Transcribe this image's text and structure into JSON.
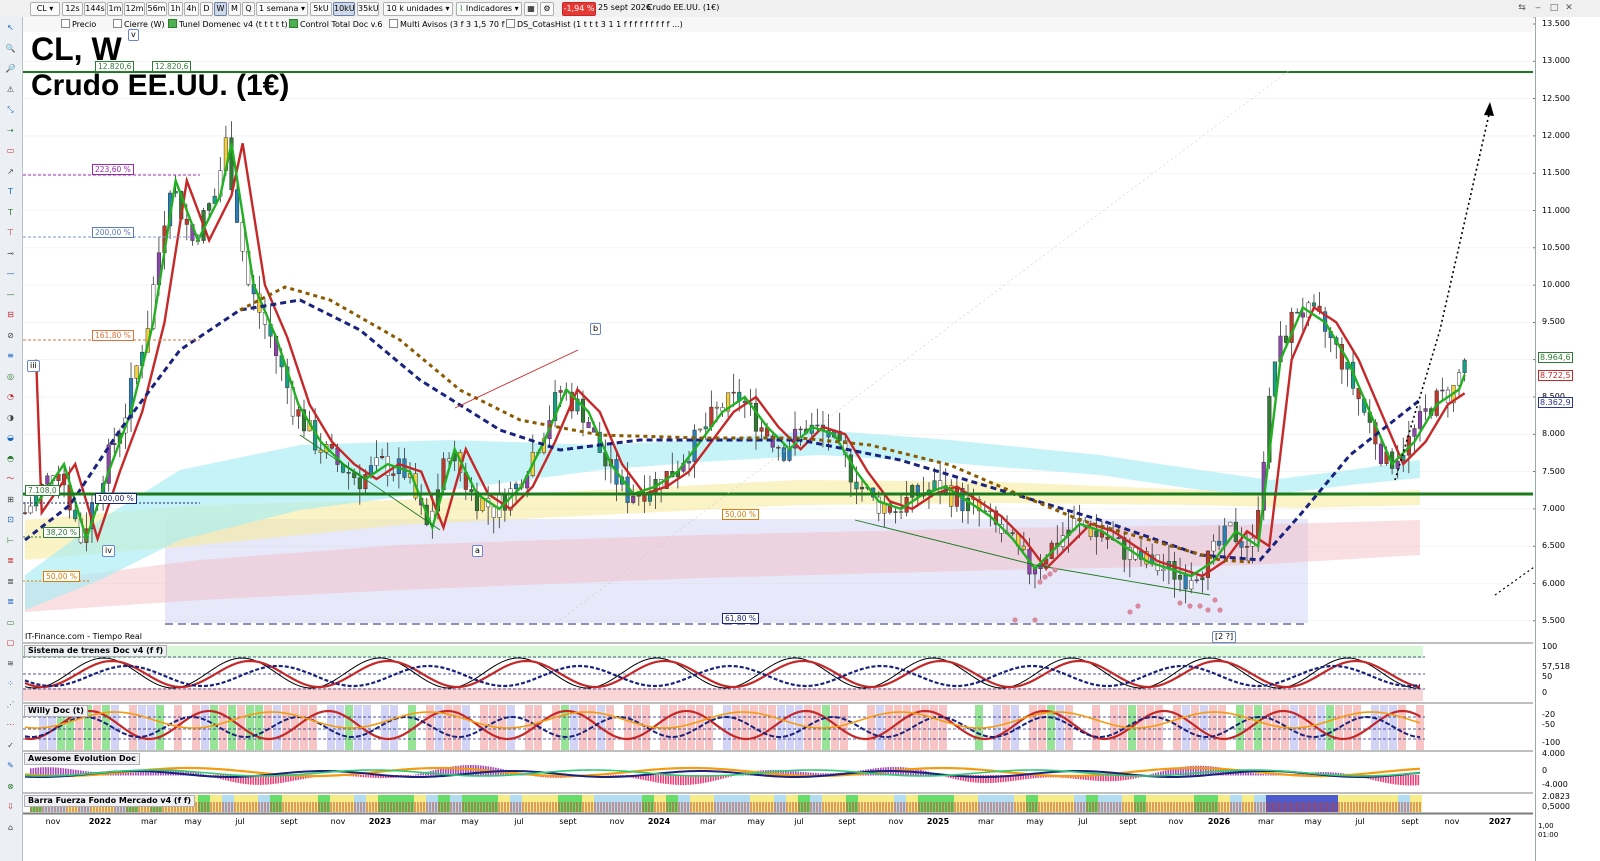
{
  "toolbar": {
    "symbol": "CL",
    "timeframes": [
      "12s",
      "144s",
      "1m",
      "12m",
      "56m",
      "1h",
      "4h",
      "D",
      "W",
      "M",
      "Q"
    ],
    "active_timeframe": "W",
    "period": "1 semana",
    "bars": [
      "5kU",
      "10kU",
      "35kU"
    ],
    "active_bar": "10kU",
    "units": "10 k unidades",
    "indicators_label": "Indicadores",
    "change_badge": "-1,94 %",
    "date_text": "25 sept 2026",
    "instrument_text": "Crudo EE.UU. (1€)"
  },
  "indicator_bar": [
    {
      "label": "Precio",
      "checked": false
    },
    {
      "label": "Cierre (W)",
      "checked": false
    },
    {
      "label": "Tunel Domenec v4 (t t t t t)",
      "checked": true
    },
    {
      "label": "Control Total Doc v.6",
      "checked": true
    },
    {
      "label": "Multi Avisos (3 f 3 1,5 70 f f)",
      "checked": false
    },
    {
      "label": "DS_CotasHist (1 t t t 3 1 1 f f f f f f f f f ...)",
      "checked": false
    }
  ],
  "chart": {
    "title_line1": "CL, W",
    "title_line2": "Crudo EE.UU. (1€)",
    "source": "IT-Finance.com - Tiempo Real",
    "price_axis": [
      "13.500",
      "13.000",
      "12.500",
      "12.000",
      "11.500",
      "11.000",
      "10.500",
      "10.000",
      "9.500",
      "9.000",
      "8.500",
      "8.000",
      "7.500",
      "7.000",
      "6.500",
      "6.000",
      "5.500"
    ],
    "price_tags": [
      {
        "text": "8.964,6",
        "color": "#2e7d32"
      },
      {
        "text": "8.722,5",
        "color": "#c62828"
      },
      {
        "text": "8.362,9",
        "color": "#283593"
      }
    ],
    "fib_labels": [
      {
        "text": "12.820,6",
        "color": "#2e7d32"
      },
      {
        "text": "12.820,6",
        "color": "#2e7d32"
      },
      {
        "text": "223,60 %",
        "color": "#9c27b0"
      },
      {
        "text": "200,00 %",
        "color": "#5c7cc0"
      },
      {
        "text": "161,80 %",
        "color": "#e0713c"
      },
      {
        "text": "7.108,0",
        "color": "#2e7d32"
      },
      {
        "text": "100,00 %",
        "color": "#1a237e"
      },
      {
        "text": "38,20 %",
        "color": "#2e7d32"
      },
      {
        "text": "50,00 %",
        "color": "#e07a00"
      },
      {
        "text": "50,00 %",
        "color": "#e07a00"
      },
      {
        "text": "61,80 %",
        "color": "#1a237e"
      }
    ],
    "wave_labels": [
      "v",
      "iii",
      "iv",
      "a",
      "b",
      "[2 ?]"
    ],
    "x_axis": [
      {
        "text": "nov",
        "bold": false
      },
      {
        "text": "2022",
        "bold": true
      },
      {
        "text": "mar",
        "bold": false
      },
      {
        "text": "may",
        "bold": false
      },
      {
        "text": "jul",
        "bold": false
      },
      {
        "text": "sept",
        "bold": false
      },
      {
        "text": "nov",
        "bold": false
      },
      {
        "text": "2023",
        "bold": true
      },
      {
        "text": "mar",
        "bold": false
      },
      {
        "text": "may",
        "bold": false
      },
      {
        "text": "jul",
        "bold": false
      },
      {
        "text": "sept",
        "bold": false
      },
      {
        "text": "nov",
        "bold": false
      },
      {
        "text": "2024",
        "bold": true
      },
      {
        "text": "mar",
        "bold": false
      },
      {
        "text": "may",
        "bold": false
      },
      {
        "text": "jul",
        "bold": false
      },
      {
        "text": "sept",
        "bold": false
      },
      {
        "text": "nov",
        "bold": false
      },
      {
        "text": "2025",
        "bold": true
      },
      {
        "text": "mar",
        "bold": false
      },
      {
        "text": "may",
        "bold": false
      },
      {
        "text": "jul",
        "bold": false
      },
      {
        "text": "sept",
        "bold": false
      },
      {
        "text": "nov",
        "bold": false
      },
      {
        "text": "2026",
        "bold": true
      },
      {
        "text": "mar",
        "bold": false
      },
      {
        "text": "may",
        "bold": false
      },
      {
        "text": "jul",
        "bold": false
      },
      {
        "text": "sept",
        "bold": false
      },
      {
        "text": "nov",
        "bold": false
      },
      {
        "text": "2027",
        "bold": true
      }
    ]
  },
  "panels": [
    {
      "label": "Sistema de trenes Doc v4 (f f)",
      "axis": [
        "100",
        "57,518",
        "50",
        "0"
      ]
    },
    {
      "label": "Willy Doc (t)",
      "axis": [
        "-20",
        "-50",
        "-100"
      ]
    },
    {
      "label": "Awesome Evolution Doc",
      "axis": [
        "4.000",
        "0",
        "-4.000"
      ]
    },
    {
      "label": "Barra Fuerza Fondo Mercado v4 (f f)",
      "axis": [
        "2.0823",
        "0,5000"
      ]
    }
  ],
  "bottom_right": {
    "line1": "1,00",
    "line2": "01:00"
  },
  "colors": {
    "green_ma": "#22b022",
    "red_ma": "#c62828",
    "blue_ma": "#1a237e",
    "brown_ma": "#8b5a00",
    "support": "#1b7a1b"
  }
}
